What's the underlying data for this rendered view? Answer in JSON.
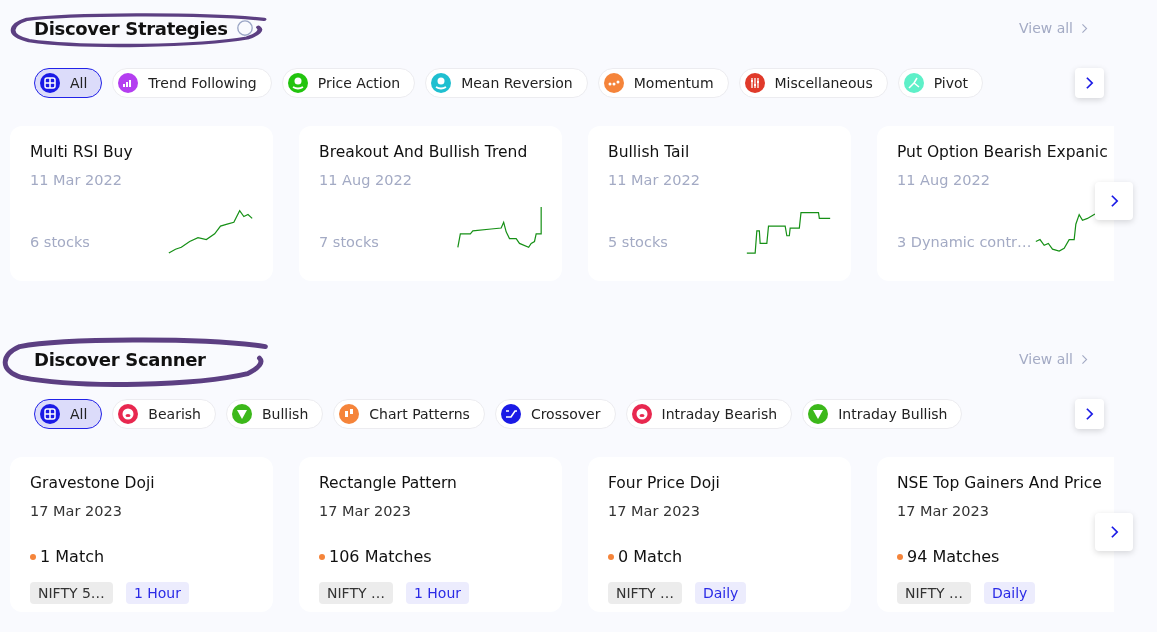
{
  "sections": [
    {
      "kind": "strategy",
      "title": "Discover Strategies",
      "view_all": "View all",
      "chips": [
        {
          "label": "All",
          "color": "#1a1ae6",
          "selected": true
        },
        {
          "label": "Trend Following",
          "color": "#b43ef0",
          "selected": false
        },
        {
          "label": "Price Action",
          "color": "#22c40e",
          "selected": false
        },
        {
          "label": "Mean Reversion",
          "color": "#1fbfd0",
          "selected": false
        },
        {
          "label": "Momentum",
          "color": "#f5843a",
          "selected": false
        },
        {
          "label": "Miscellaneous",
          "color": "#e03a2a",
          "selected": false
        },
        {
          "label": "Pivot",
          "color": "#5ef0c8",
          "selected": false
        }
      ],
      "cards": [
        {
          "title": "Multi RSI Buy",
          "date": "11 Mar 2022",
          "footer": "6 stocks"
        },
        {
          "title": "Breakout And Bullish Trend",
          "date": "11 Aug 2022",
          "footer": "7 stocks"
        },
        {
          "title": "Bullish Tail",
          "date": "11 Mar 2022",
          "footer": "5 stocks"
        },
        {
          "title": "Put Option Bearish Expanic",
          "date": "11 Aug 2022",
          "footer": "3 Dynamic contr…"
        }
      ]
    },
    {
      "kind": "scanner",
      "title": "Discover Scanner",
      "view_all": "View all",
      "chips": [
        {
          "label": "All",
          "color": "#1a1ae6",
          "selected": true
        },
        {
          "label": "Bearish",
          "color": "#e8284f",
          "selected": false
        },
        {
          "label": "Bullish",
          "color": "#3cb81a",
          "selected": false
        },
        {
          "label": "Chart Patterns",
          "color": "#f5843a",
          "selected": false
        },
        {
          "label": "Crossover",
          "color": "#1a1ae6",
          "selected": false
        },
        {
          "label": "Intraday Bearish",
          "color": "#e8284f",
          "selected": false
        },
        {
          "label": "Intraday Bullish",
          "color": "#3cb81a",
          "selected": false
        }
      ],
      "cards": [
        {
          "title": "Gravestone Doji",
          "date": "17 Mar 2023",
          "matches": "1 Match",
          "tags": [
            "NIFTY 5…",
            "1 Hour"
          ]
        },
        {
          "title": "Rectangle Pattern",
          "date": "17 Mar 2023",
          "matches": "106 Matches",
          "tags": [
            "NIFTY …",
            "1 Hour"
          ]
        },
        {
          "title": "Four Price Doji",
          "date": "17 Mar 2023",
          "matches": "0 Match",
          "tags": [
            "NIFTY …",
            "Daily"
          ]
        },
        {
          "title": "NSE Top Gainers And Price",
          "date": "17 Mar 2023",
          "matches": "94 Matches",
          "tags": [
            "NIFTY …",
            "Daily"
          ]
        }
      ]
    }
  ]
}
